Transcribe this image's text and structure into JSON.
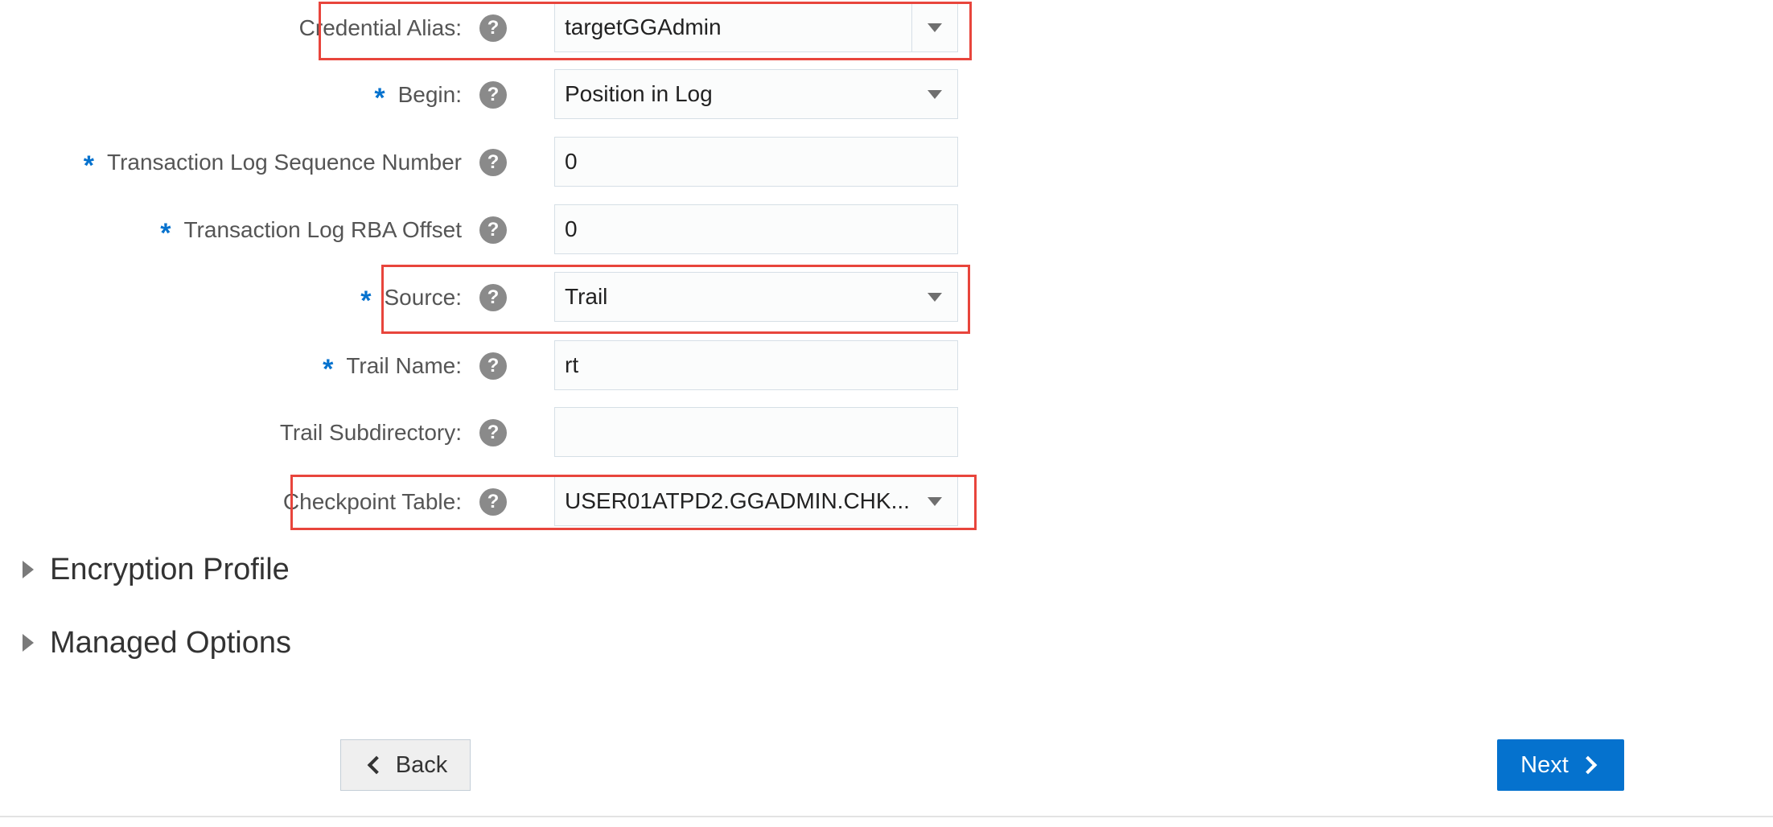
{
  "form": {
    "credential_alias": {
      "label": "Credential Alias:",
      "value": "targetGGAdmin"
    },
    "begin": {
      "label": "Begin:",
      "value": "Position in Log"
    },
    "seq_number": {
      "label": "Transaction Log Sequence Number",
      "value": "0"
    },
    "rba_offset": {
      "label": "Transaction Log RBA Offset",
      "value": "0"
    },
    "source": {
      "label": "Source:",
      "value": "Trail"
    },
    "trail_name": {
      "label": "Trail Name:",
      "value": "rt"
    },
    "trail_subdir": {
      "label": "Trail Subdirectory:",
      "value": ""
    },
    "checkpoint_table": {
      "label": "Checkpoint Table:",
      "value": "USER01ATPD2.GGADMIN.CHK..."
    },
    "required_marker": "*",
    "help_glyph": "?"
  },
  "sections": {
    "encryption": "Encryption Profile",
    "managed": "Managed Options"
  },
  "buttons": {
    "back": "Back",
    "next": "Next"
  },
  "colors": {
    "accent": "#0572ce",
    "highlight": "#e8453c"
  },
  "icons": {
    "help": "help-icon",
    "dropdown": "chevron-down-icon",
    "section_toggle": "triangle-right-icon",
    "back": "chevron-left-icon",
    "next": "chevron-right-icon"
  }
}
